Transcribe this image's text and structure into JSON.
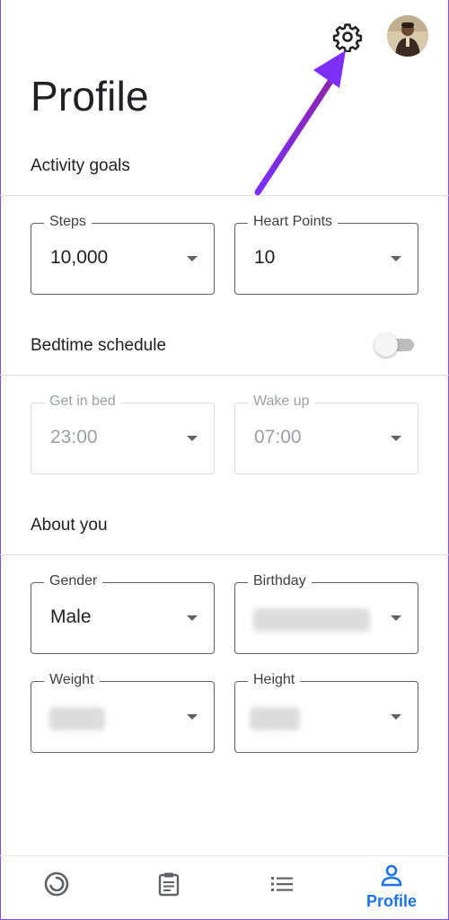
{
  "header": {
    "title": "Profile",
    "settings_icon": "gear-icon",
    "avatar_icon": "profile-avatar"
  },
  "activity_goals": {
    "label": "Activity goals",
    "steps": {
      "label": "Steps",
      "value": "10,000"
    },
    "heart_points": {
      "label": "Heart Points",
      "value": "10"
    }
  },
  "bedtime": {
    "label": "Bedtime schedule",
    "enabled": false,
    "get_in_bed": {
      "label": "Get in bed",
      "value": "23:00"
    },
    "wake_up": {
      "label": "Wake up",
      "value": "07:00"
    }
  },
  "about_you": {
    "label": "About you",
    "gender": {
      "label": "Gender",
      "value": "Male"
    },
    "birthday": {
      "label": "Birthday",
      "value_hidden": true
    },
    "weight": {
      "label": "Weight",
      "value_hidden": true
    },
    "height": {
      "label": "Height",
      "value_hidden": true
    }
  },
  "bottom_nav": {
    "items": [
      {
        "icon": "home-ring-icon"
      },
      {
        "icon": "journal-clipboard-icon"
      },
      {
        "icon": "browse-list-icon"
      },
      {
        "icon": "profile-person-icon",
        "label": "Profile",
        "active": true
      }
    ]
  },
  "colors": {
    "accent": "#1a73e8",
    "annotation_arrow": "#8a2be2",
    "outline": "#5f6368"
  }
}
